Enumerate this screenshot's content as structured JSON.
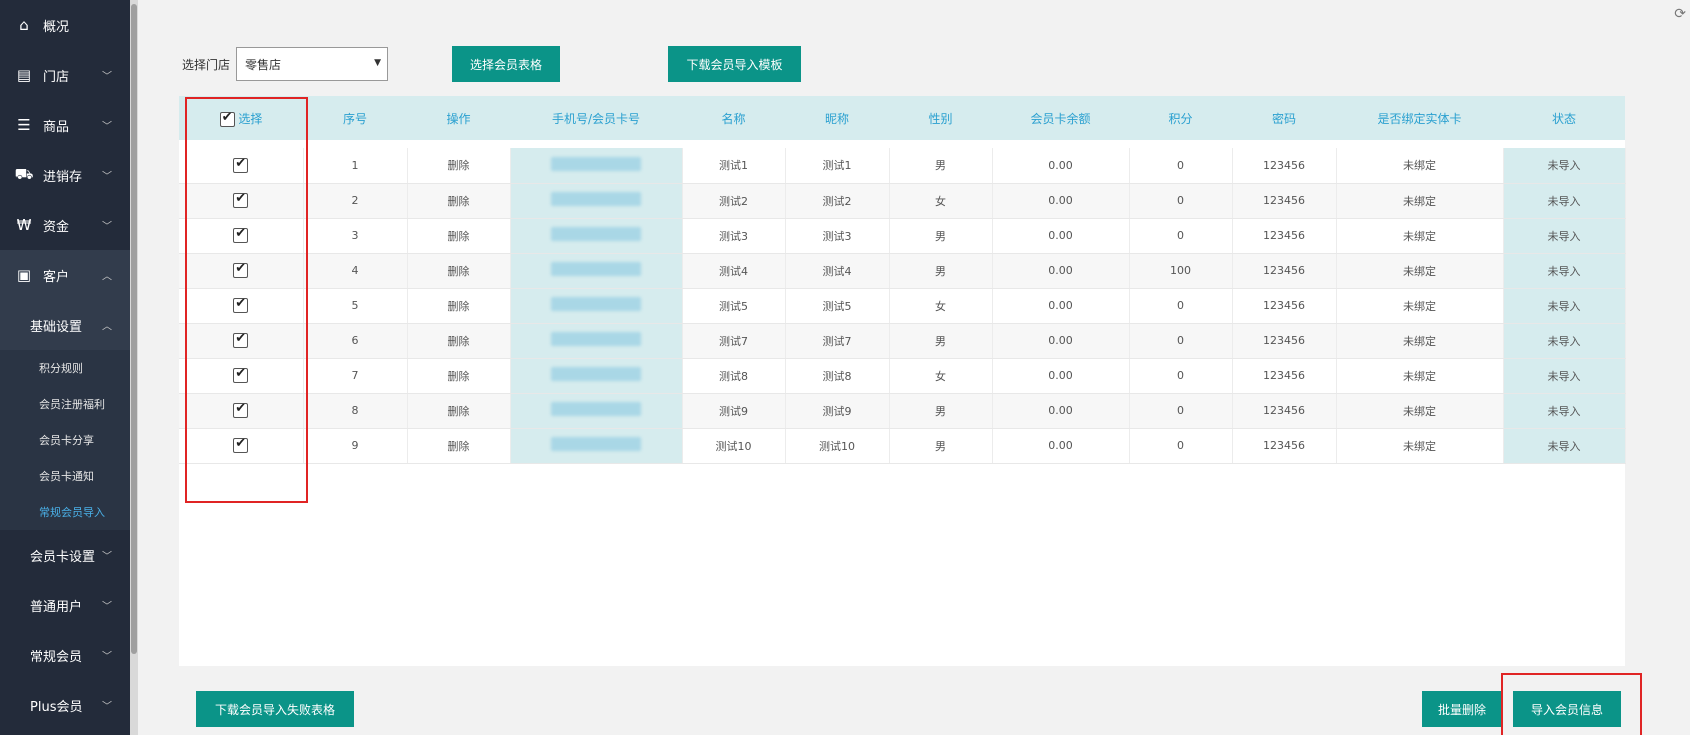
{
  "sidebar": {
    "top_items": [
      {
        "label": "概况",
        "icon": "home-icon"
      },
      {
        "label": "门店",
        "icon": "store-icon"
      },
      {
        "label": "商品",
        "icon": "list-icon"
      },
      {
        "label": "进销存",
        "icon": "truck-icon"
      },
      {
        "label": "资金",
        "icon": "won-icon"
      },
      {
        "label": "客户",
        "icon": "id-card-icon"
      }
    ],
    "basic_settings": {
      "label": "基础设置",
      "items": [
        "积分规则",
        "会员注册福利",
        "会员卡分享",
        "会员卡通知",
        "常规会员导入"
      ],
      "active": "常规会员导入"
    },
    "groups": [
      "会员卡设置",
      "普通用户",
      "常规会员",
      "Plus会员"
    ]
  },
  "toolbar": {
    "store_label": "选择门店",
    "store_value": "零售店",
    "select_table_button": "选择会员表格",
    "download_template_button": "下载会员导入模板"
  },
  "table": {
    "headers": [
      "选择",
      "序号",
      "操作",
      "手机号/会员卡号",
      "名称",
      "昵称",
      "性别",
      "会员卡余额",
      "积分",
      "密码",
      "是否绑定实体卡",
      "状态"
    ],
    "rows": [
      {
        "no": "1",
        "op": "删除",
        "name": "测试1",
        "nick": "测试1",
        "gender": "男",
        "balance": "0.00",
        "points": "0",
        "password": "123456",
        "bound": "未绑定",
        "status": "未导入"
      },
      {
        "no": "2",
        "op": "删除",
        "name": "测试2",
        "nick": "测试2",
        "gender": "女",
        "balance": "0.00",
        "points": "0",
        "password": "123456",
        "bound": "未绑定",
        "status": "未导入"
      },
      {
        "no": "3",
        "op": "删除",
        "name": "测试3",
        "nick": "测试3",
        "gender": "男",
        "balance": "0.00",
        "points": "0",
        "password": "123456",
        "bound": "未绑定",
        "status": "未导入"
      },
      {
        "no": "4",
        "op": "删除",
        "name": "测试4",
        "nick": "测试4",
        "gender": "男",
        "balance": "0.00",
        "points": "100",
        "password": "123456",
        "bound": "未绑定",
        "status": "未导入"
      },
      {
        "no": "5",
        "op": "删除",
        "name": "测试5",
        "nick": "测试5",
        "gender": "女",
        "balance": "0.00",
        "points": "0",
        "password": "123456",
        "bound": "未绑定",
        "status": "未导入"
      },
      {
        "no": "6",
        "op": "删除",
        "name": "测试7",
        "nick": "测试7",
        "gender": "男",
        "balance": "0.00",
        "points": "0",
        "password": "123456",
        "bound": "未绑定",
        "status": "未导入"
      },
      {
        "no": "7",
        "op": "删除",
        "name": "测试8",
        "nick": "测试8",
        "gender": "女",
        "balance": "0.00",
        "points": "0",
        "password": "123456",
        "bound": "未绑定",
        "status": "未导入"
      },
      {
        "no": "8",
        "op": "删除",
        "name": "测试9",
        "nick": "测试9",
        "gender": "男",
        "balance": "0.00",
        "points": "0",
        "password": "123456",
        "bound": "未绑定",
        "status": "未导入"
      },
      {
        "no": "9",
        "op": "删除",
        "name": "测试10",
        "nick": "测试10",
        "gender": "男",
        "balance": "0.00",
        "points": "0",
        "password": "123456",
        "bound": "未绑定",
        "status": "未导入"
      }
    ]
  },
  "footer": {
    "download_failed_button": "下载会员导入失败表格",
    "batch_delete_button": "批量删除",
    "import_button": "导入会员信息"
  },
  "colors": {
    "sidebar_bg": "#232b3a",
    "accent_button": "#0b9488",
    "header_text": "#2aa0d0",
    "delete_text": "#e05252",
    "highlight_box": "#e02424"
  }
}
